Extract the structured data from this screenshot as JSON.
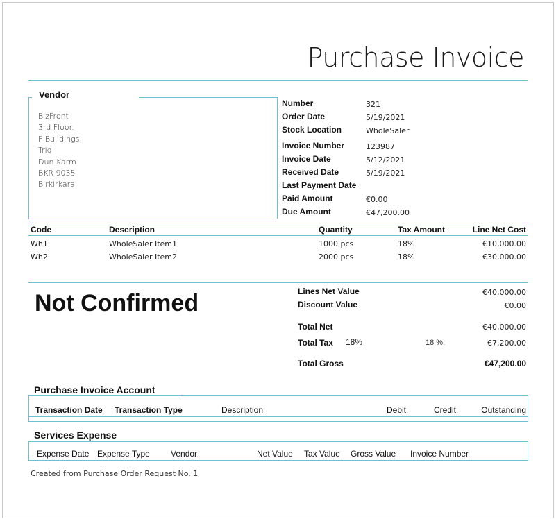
{
  "title": "Purchase Invoice",
  "vendor": {
    "legend": "Vendor",
    "address": [
      "BizFront",
      "3rd Floor.",
      "F Buildings.",
      "Triq",
      "Dun Karm",
      "BKR 9035",
      "Birkirkara"
    ]
  },
  "details": [
    {
      "label": "Number",
      "value": "321"
    },
    {
      "label": "Order Date",
      "value": "5/19/2021"
    },
    {
      "label": "Stock Location",
      "value": "WholeSaler"
    },
    {
      "label": "Invoice Number",
      "value": "123987"
    },
    {
      "label": "Invoice Date",
      "value": "5/12/2021"
    },
    {
      "label": "Received Date",
      "value": "5/19/2021"
    },
    {
      "label": "Last Payment Date",
      "value": ""
    },
    {
      "label": "Paid Amount",
      "value": "€0.00"
    },
    {
      "label": "Due Amount",
      "value": "€47,200.00"
    }
  ],
  "lines": {
    "headers": [
      "Code",
      "Description",
      "Quantity",
      "Tax Amount",
      "Line Net Cost"
    ],
    "rows": [
      [
        "Wh1",
        "WholeSaler Item1",
        "1000 pcs",
        "18%",
        "€10,000.00"
      ],
      [
        "Wh2",
        "WholeSaler Item2",
        "2000 pcs",
        "18%",
        "€30,000.00"
      ]
    ]
  },
  "status": "Not Confirmed",
  "totals": {
    "lines_net_value_label": "Lines Net Value",
    "lines_net_value": "€40,000.00",
    "discount_value_label": "Discount Value",
    "discount_value": "€0.00",
    "total_net_label": "Total Net",
    "total_net": "€40,000.00",
    "total_tax_label": "Total Tax",
    "total_tax_rate": "18%",
    "total_tax_rate2": "18 %:",
    "total_tax": "€7,200.00",
    "total_gross_label": "Total Gross",
    "total_gross": "€47,200.00"
  },
  "account": {
    "title": "Purchase Invoice Account",
    "headers": [
      "Transaction Date",
      "Transaction Type",
      "Description",
      "Debit",
      "Credit",
      "Outstanding"
    ]
  },
  "services": {
    "title": "Services Expense",
    "headers": [
      "Expense Date",
      "Expense Type",
      "Vendor",
      "Net Value",
      "Tax Value",
      "Gross Value",
      "Invoice Number"
    ]
  },
  "footer": "Created from Purchase Order Request No. 1",
  "colors": {
    "accent": "#6cc0d0"
  }
}
